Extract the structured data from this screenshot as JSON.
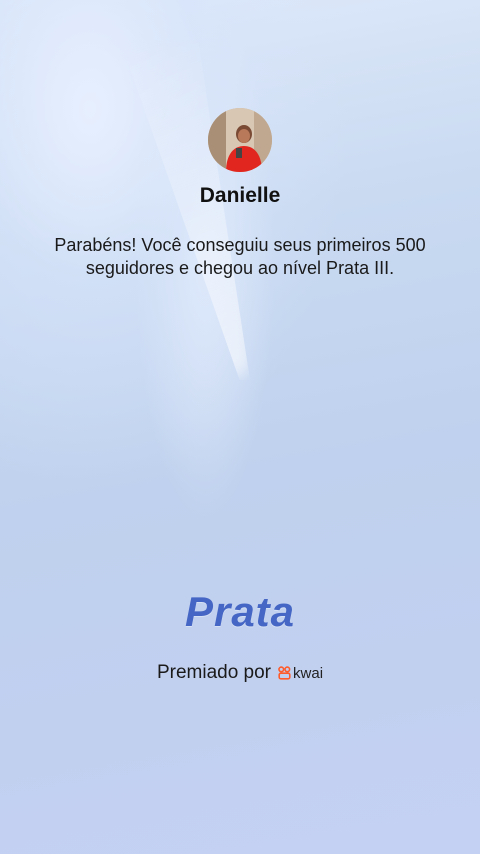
{
  "profile": {
    "name": "Danielle"
  },
  "message": "Parabéns! Você conseguiu seus primeiros 500 seguidores e chegou ao nível Prata III.",
  "level": {
    "title": "Prata"
  },
  "award": {
    "label": "Premiado por",
    "brand": "kwai",
    "brand_icon": "kwai-logo-icon",
    "brand_color": "#ff5b2b"
  },
  "colors": {
    "level_text": "#4566c4",
    "background": "#c9daf1"
  }
}
